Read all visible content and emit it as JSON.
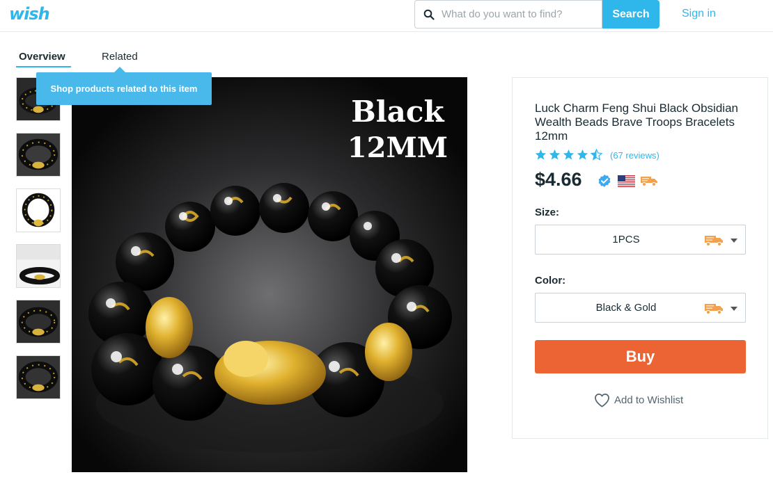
{
  "header": {
    "logo_text": "wish",
    "search": {
      "placeholder": "What do you want to find?",
      "value": "",
      "icon": "search-icon"
    },
    "search_button": "Search",
    "signin_label": "Sign in"
  },
  "tabs": [
    {
      "label": "Overview",
      "active": true
    },
    {
      "label": "Related",
      "active": false
    }
  ],
  "tooltip": "Shop products related to this item",
  "thumbnails": [
    "bracelet-thumb-1",
    "bracelet-thumb-2",
    "bracelet-thumb-3",
    "bracelet-thumb-4",
    "bracelet-thumb-5",
    "bracelet-thumb-6"
  ],
  "main_image": {
    "caption_line1": "Black",
    "caption_line2": "12MM"
  },
  "product": {
    "title": "Luck Charm Feng Shui Black Obsidian Wealth Beads Brave Troops Bracelets 12mm",
    "rating": 4.5,
    "reviews_label": "(67 reviews)",
    "price": "$4.66",
    "icons": [
      "verified-badge-icon",
      "us-flag-icon",
      "shipping-truck-icon"
    ],
    "size": {
      "label": "Size:",
      "value": "1PCS"
    },
    "color": {
      "label": "Color:",
      "value": "Black & Gold"
    },
    "buy_label": "Buy",
    "wishlist_label": "Add to Wishlist"
  },
  "colors": {
    "brand_blue": "#2fb7ec",
    "buy_orange": "#ec6334",
    "truck_orange": "#f0a24f"
  }
}
